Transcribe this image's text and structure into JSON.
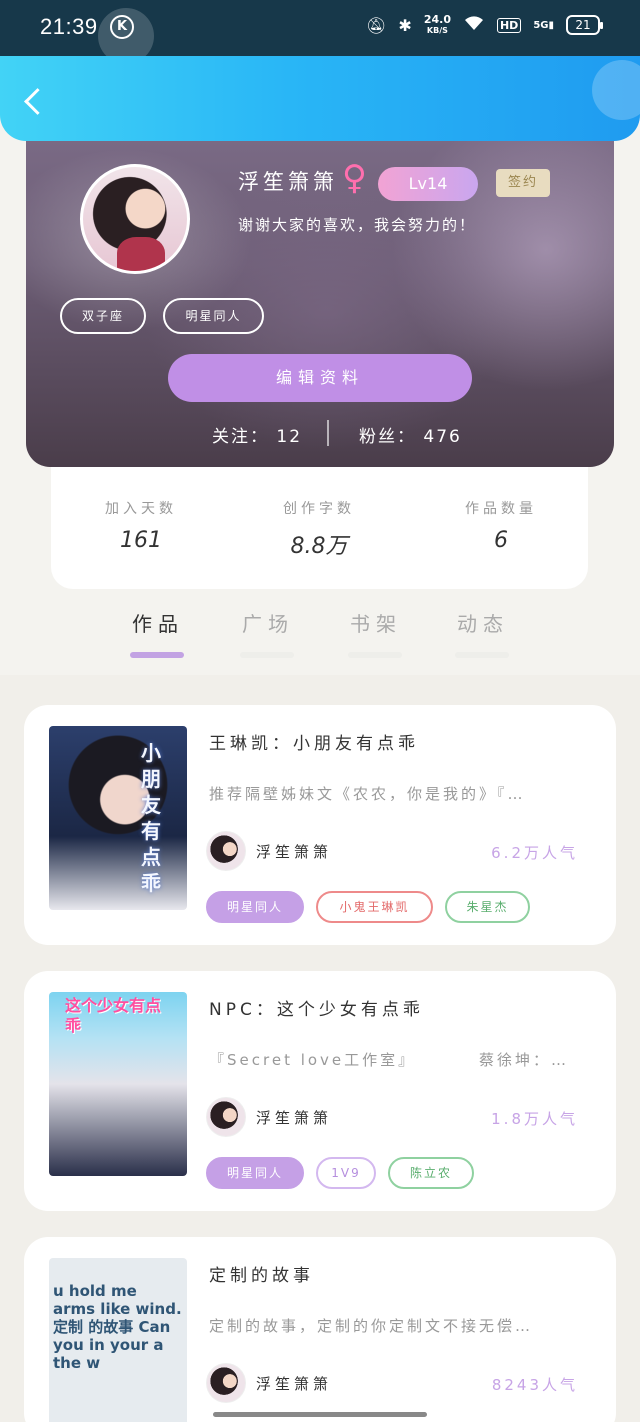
{
  "status_bar": {
    "time": "21:39",
    "k_icon": "K",
    "speed_value": "24.0",
    "speed_unit": "KB/S",
    "hd": "HD",
    "signal": "5G",
    "battery": "21",
    "icons": [
      "mute-bell-icon",
      "bluetooth-icon",
      "wifi-icon",
      "signal-icon"
    ]
  },
  "header": {
    "back_icon": "chevron-left-icon",
    "colors": {
      "start": "#42d3f6",
      "end": "#1f9bf0"
    }
  },
  "profile": {
    "name": "浮笙箫箫",
    "gender_symbol": "♀",
    "level": "Lv14",
    "signed_badge": "签约",
    "motto": "谢谢大家的喜欢，我会努力的！",
    "tags": [
      "双子座",
      "明星同人"
    ],
    "edit_button": "编辑资料",
    "following_label": "关注：",
    "following_count": "12",
    "fans_label": "粉丝：",
    "fans_count": "476"
  },
  "stats": [
    {
      "label": "加入天数",
      "value": "161"
    },
    {
      "label": "创作字数",
      "value": "8.8万"
    },
    {
      "label": "作品数量",
      "value": "6"
    }
  ],
  "tabs": [
    {
      "label": "作品",
      "active": true
    },
    {
      "label": "广场",
      "active": false
    },
    {
      "label": "书架",
      "active": false
    },
    {
      "label": "动态",
      "active": false
    }
  ],
  "works": [
    {
      "title": "王琳凯：小朋友有点乖",
      "description": "推荐隔壁姊妹文《农农，你是我的》『…",
      "author": "浮笙箫箫",
      "popularity": "6.2万人气",
      "cover_text": "小朋友有点乖",
      "tags": [
        {
          "label": "明星同人",
          "style": "purple"
        },
        {
          "label": "小鬼王琳凯",
          "style": "red"
        },
        {
          "label": "朱星杰",
          "style": "green"
        }
      ]
    },
    {
      "title": "NPC：这个少女有点乖",
      "description": "『Secret love工作室』",
      "description_extra": "蔡徐坤：…",
      "author": "浮笙箫箫",
      "popularity": "1.8万人气",
      "cover_text": "这个少女有点乖",
      "tags": [
        {
          "label": "明星同人",
          "style": "purple"
        },
        {
          "label": "1V9",
          "style": "lav"
        },
        {
          "label": "陈立农",
          "style": "green"
        }
      ]
    },
    {
      "title": "定制的故事",
      "description": "定制的故事，定制的你定制文不接无偿…",
      "author": "浮笙箫箫",
      "popularity": "8243人气",
      "cover_text": "u hold me arms like wind. 定制 的故事 Can you in your a the w",
      "tags": []
    }
  ]
}
